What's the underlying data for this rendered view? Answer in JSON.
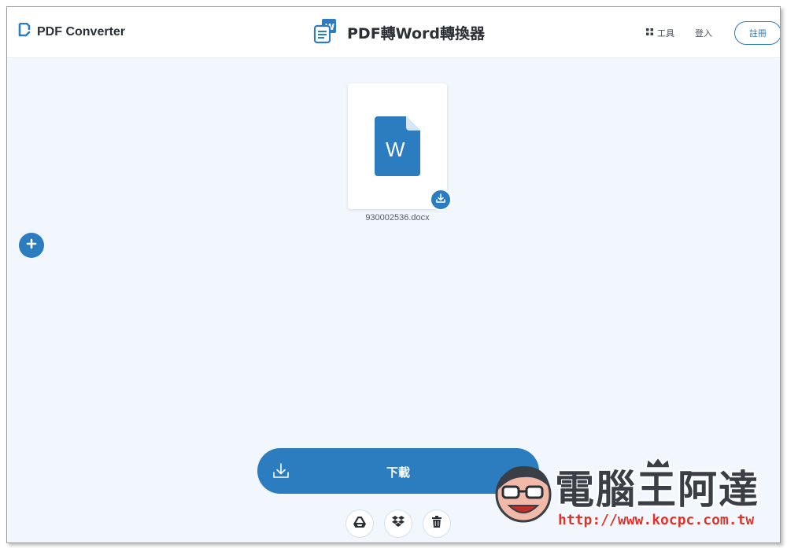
{
  "header": {
    "brand": "PDF Converter",
    "title": "PDF轉Word轉換器",
    "nav": {
      "tools_label": "工具",
      "login_label": "登入",
      "register_label": "註冊"
    }
  },
  "file": {
    "name": "930002536.docx",
    "icon_letter": "W"
  },
  "actions": {
    "download_label": "下載",
    "cloud_buttons": [
      "google-drive-icon",
      "dropbox-icon",
      "trash-icon"
    ]
  },
  "watermark": {
    "name": "電腦王阿達",
    "url": "http://www.kocpc.com.tw"
  },
  "colors": {
    "accent": "#2c7cc0",
    "background": "#f2f7fd",
    "header_bg": "#ffffff",
    "watermark_url": "#e0312b"
  }
}
